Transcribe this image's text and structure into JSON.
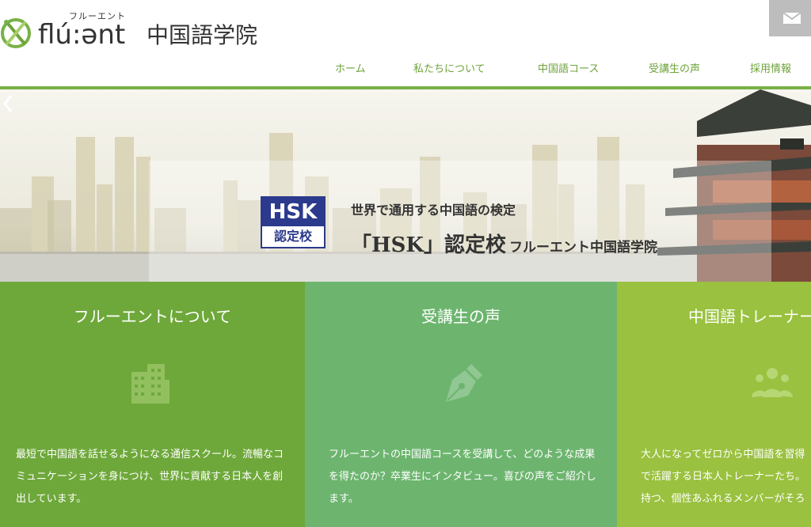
{
  "brand": {
    "logo_word": "flú:ənt",
    "logo_kana": "フルーエント",
    "school_name": "中国語学院"
  },
  "nav": {
    "items": [
      "ホーム",
      "私たちについて",
      "中国語コース",
      "受講生の声",
      "採用情報"
    ]
  },
  "hero": {
    "badge_top": "HSK",
    "badge_bottom": "認定校",
    "subtitle": "世界で通用する中国語の検定",
    "main_title": "「HSK」認定校",
    "main_title_small": "フルーエント中国語学院"
  },
  "cards": [
    {
      "title": "フルーエントについて",
      "icon": "building-icon",
      "description": "最短で中国語を話せるようになる通信スクール。流暢なコミュニケーションを身につけ、世界に貢献する日本人を創出しています。"
    },
    {
      "title": "受講生の声",
      "icon": "pen-nib-icon",
      "description": "フルーエントの中国語コースを受講して、どのような成果を得たのか？卒業生にインタビュー。喜びの声をご紹介します。"
    },
    {
      "title": "中国語トレーナー",
      "icon": "people-group-icon",
      "description_lines": [
        "大人になってゼロから中国語を習得",
        "で活躍する日本人トレーナーたち。",
        "持つ、個性あふれるメンバーがそろ"
      ]
    }
  ],
  "colors": {
    "accent_green": "#78b146",
    "nav_text": "#6ea33b",
    "card1": "#6ea83a",
    "card2": "#6db56f",
    "card3": "#9ac13f",
    "hsk_blue": "#2b3a8c"
  }
}
